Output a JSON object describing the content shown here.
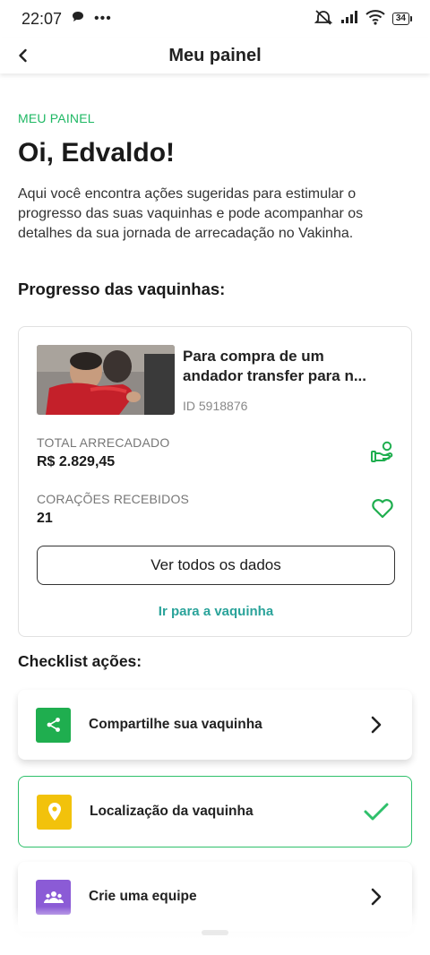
{
  "status": {
    "time": "22:07",
    "battery": "34"
  },
  "header": {
    "title": "Meu painel"
  },
  "dashboard": {
    "eyebrow": "MEU PAINEL",
    "greeting": "Oi, Edvaldo!",
    "intro": "Aqui você encontra ações sugeridas para estimular o progresso das suas vaquinhas e pode acompanhar os detalhes da sua jornada de arrecadação no Vakinha."
  },
  "progress": {
    "section_title": "Progresso das vaquinhas:",
    "campaign": {
      "title_line1": "Para compra de um",
      "title_line2": "andador transfer para n...",
      "id": "ID 5918876",
      "raised_label": "TOTAL ARRECADADO",
      "raised_value": "R$ 2.829,45",
      "hearts_label": "CORAÇÕES RECEBIDOS",
      "hearts_value": "21",
      "view_all_label": "Ver todos os dados",
      "go_link_label": "Ir para a vaquinha"
    }
  },
  "checklist": {
    "section_title": "Checklist ações:",
    "items": [
      {
        "label": "Compartilhe sua vaquinha",
        "icon": "share-icon",
        "color": "#1fae4f",
        "state": "pending"
      },
      {
        "label": "Localização da vaquinha",
        "icon": "location-pin-icon",
        "color": "#f2c20b",
        "state": "done"
      },
      {
        "label": "Crie uma equipe",
        "icon": "team-icon",
        "color": "#8b5bd6",
        "state": "pending"
      }
    ]
  },
  "colors": {
    "accent_green": "#1fb864",
    "link_teal": "#2aa39a"
  }
}
